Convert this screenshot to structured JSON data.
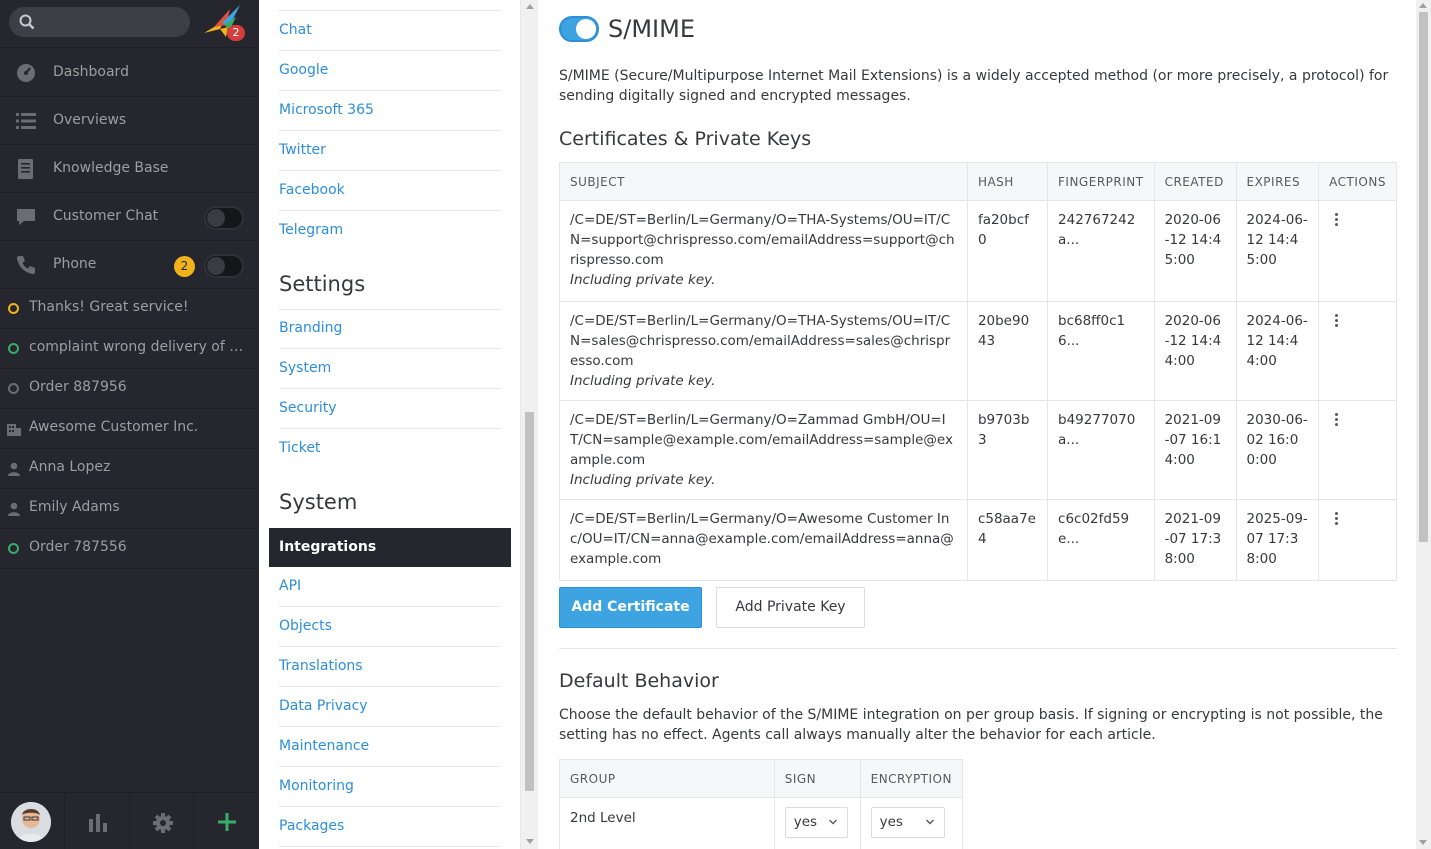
{
  "nav": {
    "notification_count": "2",
    "items": [
      {
        "label": "Dashboard",
        "icon": "dashboard-icon"
      },
      {
        "label": "Overviews",
        "icon": "list-icon"
      },
      {
        "label": "Knowledge Base",
        "icon": "book-icon"
      },
      {
        "label": "Customer Chat",
        "icon": "chat-icon"
      },
      {
        "label": "Phone",
        "icon": "phone-icon",
        "badge": "2"
      }
    ],
    "tasks": [
      {
        "label": "Thanks! Great service!",
        "icon": "ticket-open-icon",
        "color": "#f0b31c"
      },
      {
        "label": "complaint wrong delivery of ord...",
        "icon": "ticket-open-icon",
        "color": "#38ad69"
      },
      {
        "label": "Order 887956",
        "icon": "ticket-closed-icon",
        "color": "#6c6d72"
      },
      {
        "label": "Awesome Customer Inc.",
        "icon": "organization-icon",
        "color": "#6c6d72"
      },
      {
        "label": "Anna Lopez",
        "icon": "user-icon",
        "color": "#6c6d72"
      },
      {
        "label": "Emily Adams",
        "icon": "user-icon",
        "color": "#6c6d72"
      },
      {
        "label": "Order 787556",
        "icon": "ticket-open-icon",
        "color": "#38ad69"
      }
    ]
  },
  "menu": {
    "channels": [
      "Chat",
      "Google",
      "Microsoft 365",
      "Twitter",
      "Facebook",
      "Telegram"
    ],
    "settings_heading": "Settings",
    "settings": [
      "Branding",
      "System",
      "Security",
      "Ticket"
    ],
    "system_heading": "System",
    "system": [
      "Integrations",
      "API",
      "Objects",
      "Translations",
      "Data Privacy",
      "Maintenance",
      "Monitoring",
      "Packages"
    ]
  },
  "main": {
    "title": "S/MIME",
    "description": "S/MIME (Secure/Multipurpose Internet Mail Extensions) is a widely accepted method (or more precisely, a protocol) for sending digitally signed and encrypted messages.",
    "certs_heading": "Certificates & Private Keys",
    "cert_columns": [
      "SUBJECT",
      "HASH",
      "FINGERPRINT",
      "CREATED",
      "EXPIRES",
      "ACTIONS"
    ],
    "certs": [
      {
        "subject": "/C=DE/ST=Berlin/L=Germany/O=THA-Systems/OU=IT/CN=support@chrispresso.com/emailAddress=support@chrispresso.com",
        "note": "Including private key.",
        "hash": "fa20bcf0",
        "fingerprint": "242767242a...",
        "created": "2020-06-12 14:45:00",
        "expires": "2024-06-12 14:45:00"
      },
      {
        "subject": "/C=DE/ST=Berlin/L=Germany/O=THA-Systems/OU=IT/CN=sales@chrispresso.com/emailAddress=sales@chrispresso.com",
        "note": "Including private key.",
        "hash": "20be9043",
        "fingerprint": "bc68ff0c16...",
        "created": "2020-06-12 14:44:00",
        "expires": "2024-06-12 14:44:00"
      },
      {
        "subject": "/C=DE/ST=Berlin/L=Germany/O=Zammad GmbH/OU=IT/CN=sample@example.com/emailAddress=sample@example.com",
        "note": "Including private key.",
        "hash": "b9703b3",
        "fingerprint": "b49277070a...",
        "created": "2021-09-07 16:14:00",
        "expires": "2030-06-02 16:00:00"
      },
      {
        "subject": "/C=DE/ST=Berlin/L=Germany/O=Awesome Customer Inc/OU=IT/CN=anna@example.com/emailAddress=anna@example.com",
        "note": "",
        "hash": "c58aa7e4",
        "fingerprint": "c6c02fd59e...",
        "created": "2021-09-07 17:38:00",
        "expires": "2025-09-07 17:38:00"
      }
    ],
    "add_certificate": "Add Certificate",
    "add_private_key": "Add Private Key",
    "default_heading": "Default Behavior",
    "default_description": "Choose the default behavior of the S/MIME integration on per group basis. If signing or encrypting is not possible, the setting has no effect. Agents call always manually alter the behavior for each article.",
    "group_columns": [
      "GROUP",
      "SIGN",
      "ENCRYPTION"
    ],
    "groups": [
      {
        "name": "2nd Level",
        "sign": "yes",
        "encryption": "yes"
      }
    ]
  }
}
